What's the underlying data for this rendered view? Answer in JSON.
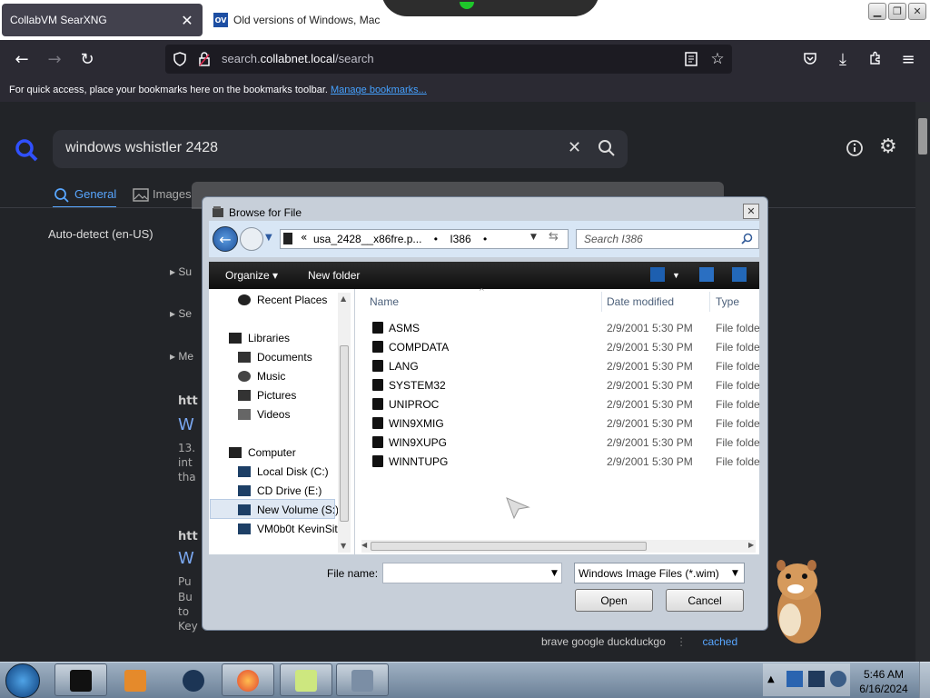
{
  "browser": {
    "tabs": [
      {
        "title": "CollabVM SearXNG",
        "active": true
      },
      {
        "title": "Old versions of Windows, Mac",
        "active": false,
        "favicon_text": "OV"
      }
    ],
    "url_prefix": "search.",
    "url_host": "collabnet.local",
    "url_path": "/search",
    "bookmarks_text": "For quick access, place your bookmarks here on the bookmarks toolbar.",
    "bookmarks_link": "Manage bookmarks..."
  },
  "searx": {
    "query": "windows wshistler 2428",
    "categories": [
      {
        "label": "General",
        "active": true
      },
      {
        "label": "Images",
        "active": false
      }
    ],
    "language": "Auto-detect (en-US)",
    "partial_labels": {
      "expand_1": "Su",
      "expand_2": "Se",
      "expand_3": "Me",
      "result1_url": "htt",
      "result1_title": "W",
      "result1_snip1": "13.",
      "result1_snip2": "int",
      "result1_snip3": "tha",
      "result2_url": "htt",
      "result2_title": "W",
      "result2_snip1": "Pu",
      "result2_snip2": "Bu",
      "result2_snip3": "to",
      "result2_snip4": "Key"
    },
    "engines": "brave  google  duckduckgo",
    "cached": "cached"
  },
  "dialog": {
    "title": "Browse for File",
    "breadcrumb": [
      "usa_2428__x86fre.p...",
      "I386"
    ],
    "search_placeholder": "Search I386",
    "toolbar": {
      "organize": "Organize",
      "new_folder": "New folder"
    },
    "nav_items": [
      {
        "label": "Recent Places",
        "icon": "recent-places-icon"
      },
      {
        "label": "Libraries",
        "icon": "libraries-icon"
      },
      {
        "label": "Documents",
        "icon": "documents-icon"
      },
      {
        "label": "Music",
        "icon": "music-icon"
      },
      {
        "label": "Pictures",
        "icon": "pictures-icon"
      },
      {
        "label": "Videos",
        "icon": "videos-icon"
      },
      {
        "label": "Computer",
        "icon": "computer-icon"
      },
      {
        "label": "Local Disk (C:)",
        "icon": "drive-icon"
      },
      {
        "label": "CD Drive (E:)",
        "icon": "cd-drive-icon"
      },
      {
        "label": "New Volume (S:)",
        "icon": "drive-icon",
        "selected": true
      },
      {
        "label": "VM0b0t KevinSite",
        "icon": "network-drive-icon"
      }
    ],
    "columns": {
      "name": "Name",
      "date": "Date modified",
      "type": "Type"
    },
    "files": [
      {
        "name": "ASMS",
        "date": "2/9/2001 5:30 PM",
        "type": "File folde"
      },
      {
        "name": "COMPDATA",
        "date": "2/9/2001 5:30 PM",
        "type": "File folde"
      },
      {
        "name": "LANG",
        "date": "2/9/2001 5:30 PM",
        "type": "File folde"
      },
      {
        "name": "SYSTEM32",
        "date": "2/9/2001 5:30 PM",
        "type": "File folde"
      },
      {
        "name": "UNIPROC",
        "date": "2/9/2001 5:30 PM",
        "type": "File folde"
      },
      {
        "name": "WIN9XMIG",
        "date": "2/9/2001 5:30 PM",
        "type": "File folde"
      },
      {
        "name": "WIN9XUPG",
        "date": "2/9/2001 5:30 PM",
        "type": "File folde"
      },
      {
        "name": "WINNTUPG",
        "date": "2/9/2001 5:30 PM",
        "type": "File folde"
      }
    ],
    "file_name_label": "File name:",
    "file_name_value": "",
    "filter": "Windows Image Files (*.wim)",
    "open_label": "Open",
    "cancel_label": "Cancel"
  },
  "taskbar": {
    "time": "5:46 AM",
    "date": "6/16/2024"
  },
  "colors": {
    "accent": "#58a6ff",
    "firefox_toolbar": "#2b2a33",
    "page_bg": "#222428",
    "taskbar": "#7d91a6"
  }
}
